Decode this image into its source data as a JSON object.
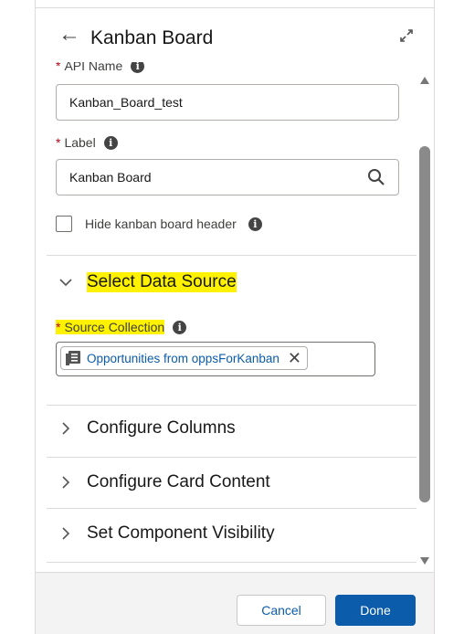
{
  "header": {
    "back_glyph": "←",
    "title": "Kanban Board"
  },
  "fields": {
    "api_name": {
      "label": "API Name",
      "value": "Kanban_Board_test"
    },
    "label": {
      "label": "Label",
      "value": "Kanban Board"
    },
    "hide_header": {
      "label": "Hide kanban board header",
      "checked": false
    }
  },
  "sections": {
    "data_source": {
      "title": "Select Data Source",
      "source_collection_label": "Source Collection",
      "source_collection_value": "Opportunities from oppsForKanban"
    },
    "configure_columns": "Configure Columns",
    "configure_card": "Configure Card Content",
    "visibility": "Set Component Visibility"
  },
  "footer": {
    "cancel_label": "Cancel",
    "done_label": "Done"
  },
  "colors": {
    "required": "#ba0517",
    "link": "#0b5cab",
    "highlight": "#fff200",
    "primary_button": "#0b5cab"
  },
  "icons": {
    "back": "back-arrow-icon",
    "expand": "expand-icon",
    "info": "info-icon",
    "search": "search-icon",
    "collection": "collection-icon",
    "close": "close-icon",
    "chevron_down": "chevron-down-icon",
    "chevron_right": "chevron-right-icon"
  }
}
